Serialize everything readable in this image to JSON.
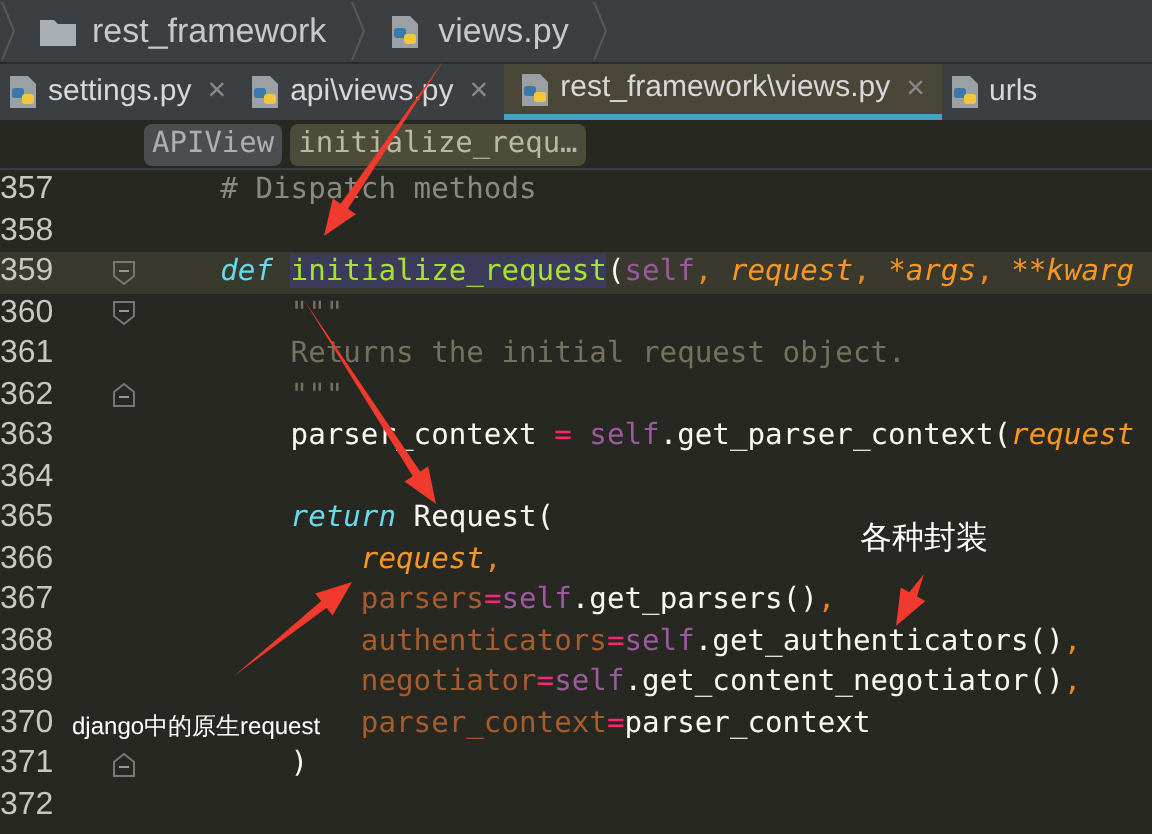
{
  "breadcrumb": [
    {
      "label": "rest_framework",
      "kind": "folder"
    },
    {
      "label": "views.py",
      "kind": "file"
    }
  ],
  "tabs": [
    {
      "label": "settings.py",
      "selected": false,
      "close": "×"
    },
    {
      "label": "api\\views.py",
      "selected": false,
      "close": "×"
    },
    {
      "label": "rest_framework\\views.py",
      "selected": true,
      "close": "×"
    },
    {
      "label": "urls",
      "selected": false
    }
  ],
  "structure": [
    {
      "label": "APIView",
      "kind": "class"
    },
    {
      "label": "initialize_requ…",
      "kind": "method"
    }
  ],
  "code_lines": [
    {
      "number": "357",
      "current": false,
      "tokens": [
        {
          "text": "    # Dispatch methods",
          "kind": "comment"
        }
      ]
    },
    {
      "number": "358",
      "current": false
    },
    {
      "number": "359",
      "current": true,
      "fold_start": true,
      "tokens": [
        {
          "text": "    def ",
          "kind": "keyword"
        },
        {
          "text": "initialize_request",
          "kind": "func"
        },
        {
          "text": "(",
          "kind": "plain"
        },
        {
          "text": "self",
          "kind": "self"
        },
        {
          "text": ", ",
          "kind": "comma"
        },
        {
          "text": "request",
          "kind": "param"
        },
        {
          "text": ", ",
          "kind": "comma"
        },
        {
          "text": "*args",
          "kind": "param"
        },
        {
          "text": ", ",
          "kind": "comma"
        },
        {
          "text": "**kwarg",
          "kind": "param"
        }
      ]
    },
    {
      "number": "360",
      "current": false,
      "fold_start": true,
      "tokens": [
        {
          "text": "        \"\"\"",
          "kind": "doc"
        }
      ]
    },
    {
      "number": "361",
      "current": false,
      "tokens": [
        {
          "text": "        Returns the initial request object.",
          "kind": "doc"
        }
      ]
    },
    {
      "number": "362",
      "current": false,
      "fold_end": true,
      "tokens": [
        {
          "text": "        \"\"\"",
          "kind": "doc"
        }
      ]
    },
    {
      "number": "363",
      "current": false,
      "tokens": [
        {
          "text": "        parser_context ",
          "kind": "plain"
        },
        {
          "text": "= ",
          "kind": "op"
        },
        {
          "text": "self",
          "kind": "self"
        },
        {
          "text": ".get_parser_context(",
          "kind": "plain"
        },
        {
          "text": "request",
          "kind": "param"
        }
      ]
    },
    {
      "number": "364",
      "current": false
    },
    {
      "number": "365",
      "current": false,
      "tokens": [
        {
          "text": "        return ",
          "kind": "keyword"
        },
        {
          "text": "Request(",
          "kind": "plain"
        }
      ]
    },
    {
      "number": "366",
      "current": false,
      "tokens": [
        {
          "text": "            request",
          "kind": "param"
        },
        {
          "text": ",",
          "kind": "comma"
        }
      ]
    },
    {
      "number": "367",
      "current": false,
      "tokens": [
        {
          "text": "            parsers",
          "kind": "kwarg"
        },
        {
          "text": "=",
          "kind": "op"
        },
        {
          "text": "self",
          "kind": "self"
        },
        {
          "text": ".get_parsers()",
          "kind": "plain"
        },
        {
          "text": ",",
          "kind": "comma"
        }
      ]
    },
    {
      "number": "368",
      "current": false,
      "tokens": [
        {
          "text": "            authenticators",
          "kind": "kwarg"
        },
        {
          "text": "=",
          "kind": "op"
        },
        {
          "text": "self",
          "kind": "self"
        },
        {
          "text": ".get_authenticators()",
          "kind": "plain"
        },
        {
          "text": ",",
          "kind": "comma"
        }
      ]
    },
    {
      "number": "369",
      "current": false,
      "tokens": [
        {
          "text": "            negotiator",
          "kind": "kwarg"
        },
        {
          "text": "=",
          "kind": "op"
        },
        {
          "text": "self",
          "kind": "self"
        },
        {
          "text": ".get_content_negotiator()",
          "kind": "plain"
        },
        {
          "text": ",",
          "kind": "comma"
        }
      ]
    },
    {
      "number": "370",
      "current": false,
      "tokens": [
        {
          "text": "            parser_context",
          "kind": "kwarg"
        },
        {
          "text": "=",
          "kind": "op"
        },
        {
          "text": "parser_context",
          "kind": "plain"
        }
      ]
    },
    {
      "number": "371",
      "current": false,
      "fold_end": true,
      "tokens": [
        {
          "text": "        )",
          "kind": "plain"
        }
      ]
    },
    {
      "number": "372",
      "current": false
    }
  ],
  "annotations": [
    {
      "text": "各种封装",
      "kind": "wrappers"
    },
    {
      "text": "django中的原生request",
      "kind": "native"
    }
  ]
}
